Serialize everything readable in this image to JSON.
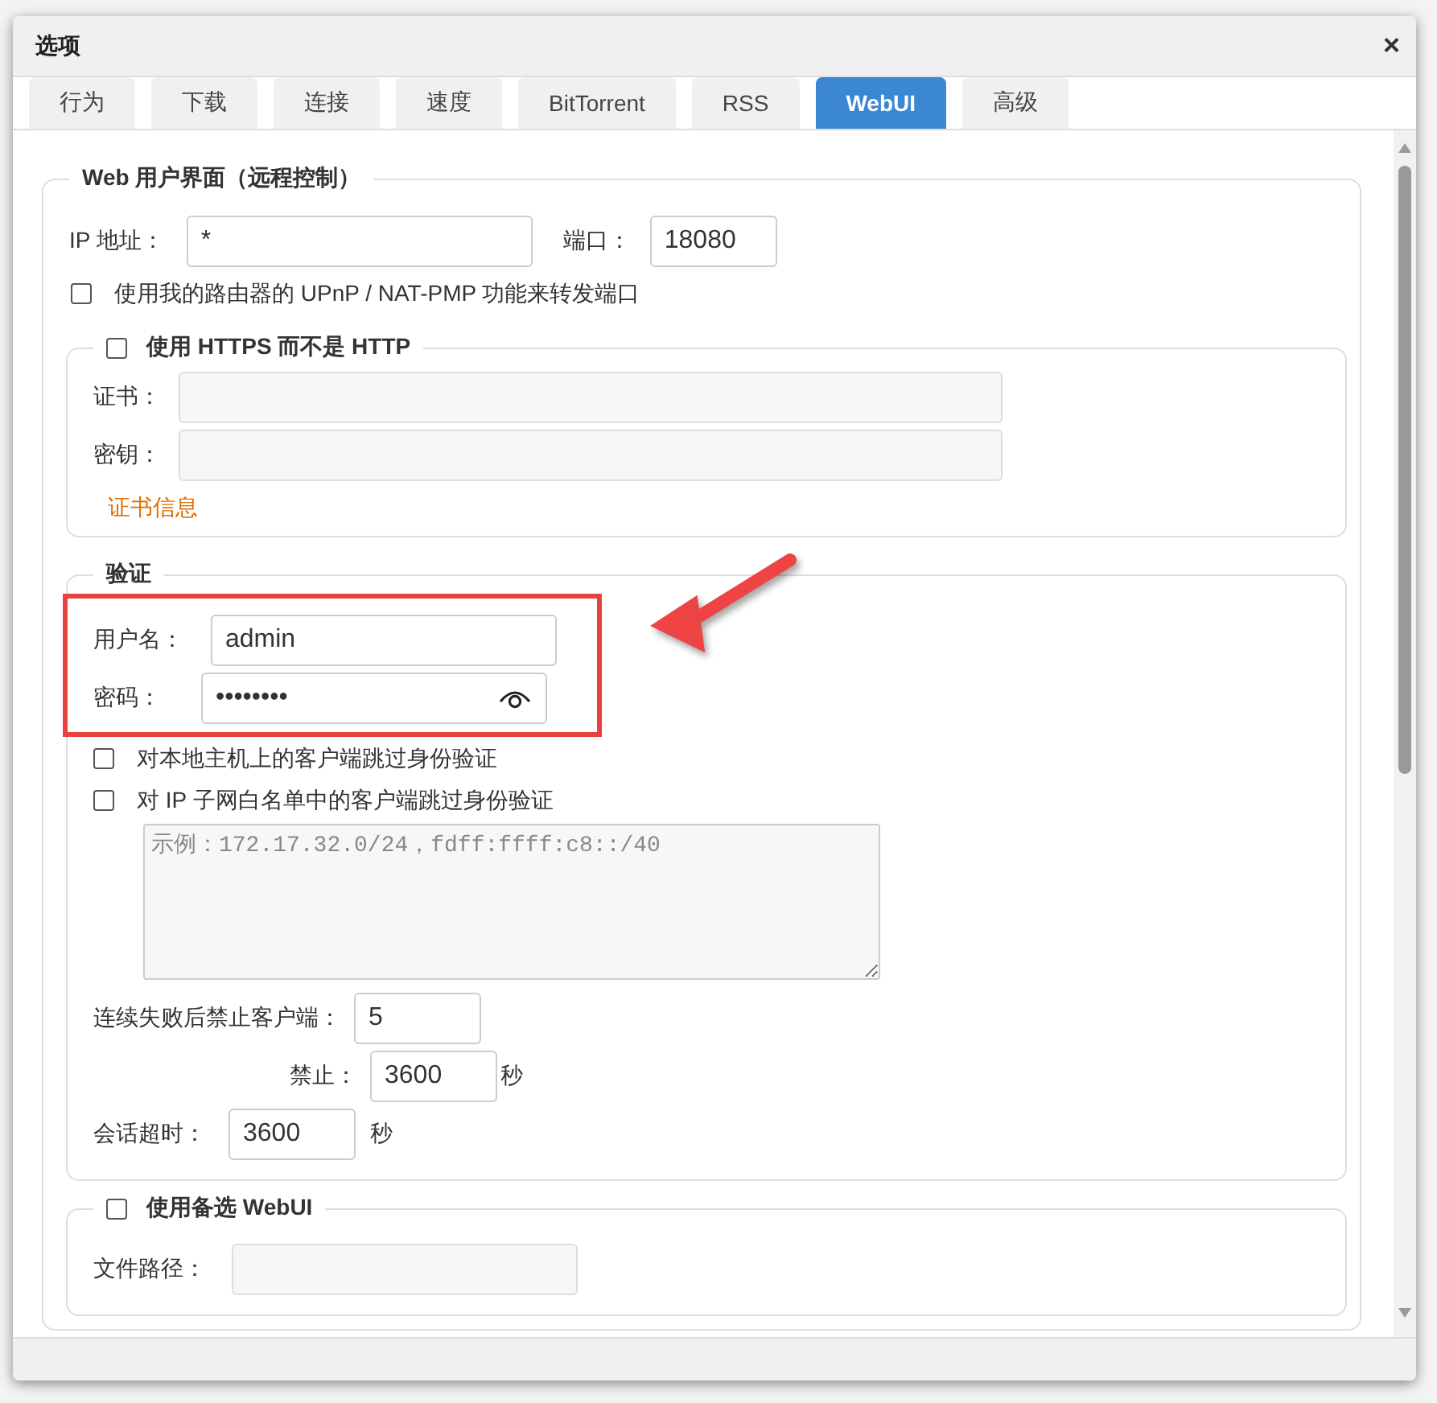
{
  "window": {
    "title": "选项",
    "close": "×"
  },
  "tabs": [
    {
      "label": "行为",
      "selected": false
    },
    {
      "label": "下载",
      "selected": false
    },
    {
      "label": "连接",
      "selected": false
    },
    {
      "label": "速度",
      "selected": false
    },
    {
      "label": "BitTorrent",
      "selected": false
    },
    {
      "label": "RSS",
      "selected": false
    },
    {
      "label": "WebUI",
      "selected": true
    },
    {
      "label": "高级",
      "selected": false
    }
  ],
  "webui": {
    "legend": "Web 用户界面（远程控制）",
    "ip_label": "IP 地址：",
    "ip_value": "*",
    "port_label": "端口：",
    "port_value": "18080",
    "upnp": {
      "label": "使用我的路由器的 UPnP / NAT-PMP 功能来转发端口",
      "checked": false
    },
    "https": {
      "label": "使用 HTTPS 而不是 HTTP",
      "checked": false,
      "cert_label": "证书：",
      "key_label": "密钥：",
      "info_link": "证书信息"
    },
    "auth": {
      "legend": "验证",
      "username_label": "用户名：",
      "username": "admin",
      "password_label": "密码：",
      "password": "••••••••",
      "skip_local": {
        "label": "对本地主机上的客户端跳过身份验证",
        "checked": false
      },
      "skip_whitelist": {
        "label": "对 IP 子网白名单中的客户端跳过身份验证",
        "checked": false
      },
      "whitelist_placeholder": "示例：172.17.32.0/24，fdff:ffff:c8::/40",
      "ban_label": "连续失败后禁止客户端：",
      "ban_value": "5",
      "ban_time_label": "禁止：",
      "ban_time": "3600",
      "ban_unit": "秒",
      "session_label": "会话超时：",
      "session_value": "3600",
      "session_unit": "秒"
    },
    "alt": {
      "label": "使用备选 WebUI",
      "checked": false,
      "path_label": "文件路径："
    }
  },
  "annotations": {
    "highlight_box": true,
    "arrow": true
  }
}
